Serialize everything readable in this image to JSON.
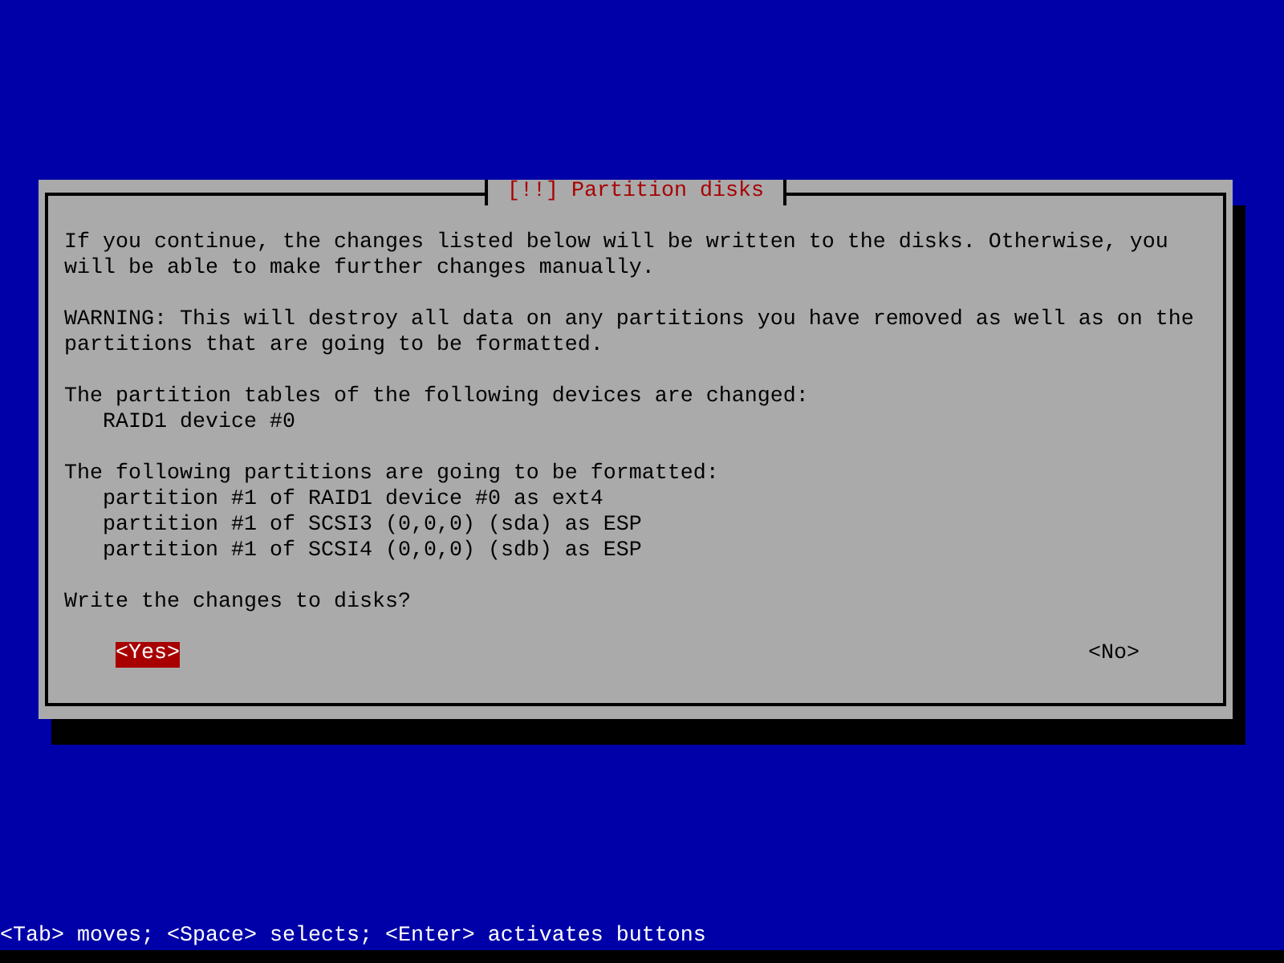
{
  "dialog": {
    "title": "[!!] Partition disks",
    "paragraphs": [
      "If you continue, the changes listed below will be written to the disks. Otherwise, you will be able to make further changes manually.",
      "WARNING: This will destroy all data on any partitions you have removed as well as on the partitions that are going to be formatted."
    ],
    "sections": [
      {
        "heading": "The partition tables of the following devices are changed:",
        "items": [
          "RAID1 device #0"
        ]
      },
      {
        "heading": "The following partitions are going to be formatted:",
        "items": [
          "partition #1 of RAID1 device #0 as ext4",
          "partition #1 of SCSI3 (0,0,0) (sda) as ESP",
          "partition #1 of SCSI4 (0,0,0) (sdb) as ESP"
        ]
      }
    ],
    "question": "Write the changes to disks?",
    "buttons": [
      {
        "label": "<Yes>",
        "selected": true
      },
      {
        "label": "<No>",
        "selected": false
      }
    ]
  },
  "status_bar": "<Tab> moves; <Space> selects; <Enter> activates buttons"
}
